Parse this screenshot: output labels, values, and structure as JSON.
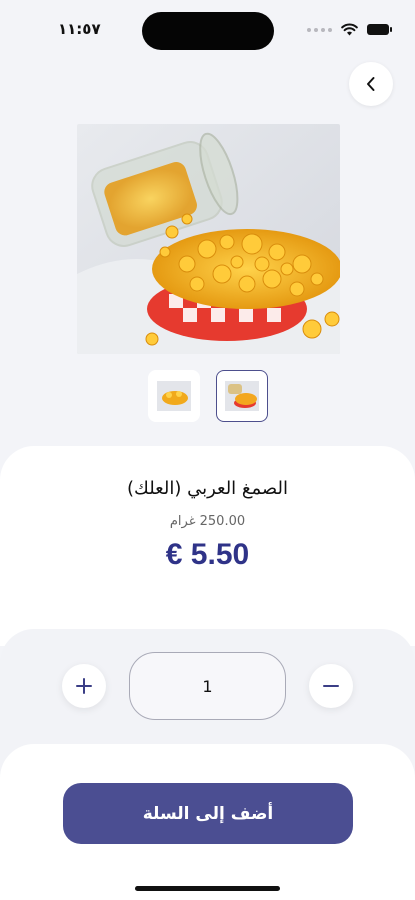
{
  "status_bar": {
    "time": "١١:٥٧"
  },
  "product": {
    "name": "الصمغ العربي (العلك)",
    "weight": "250.00 غرام",
    "price": "€ 5.50"
  },
  "quantity": {
    "value": "1"
  },
  "actions": {
    "add_to_cart_label": "أضف إلى السلة"
  },
  "icons": {
    "back": "chevron-left-icon",
    "increase": "plus-icon",
    "decrease": "minus-icon"
  },
  "colors": {
    "accent": "#4b4e92",
    "price": "#2f3388",
    "background": "#f3f4f8"
  }
}
